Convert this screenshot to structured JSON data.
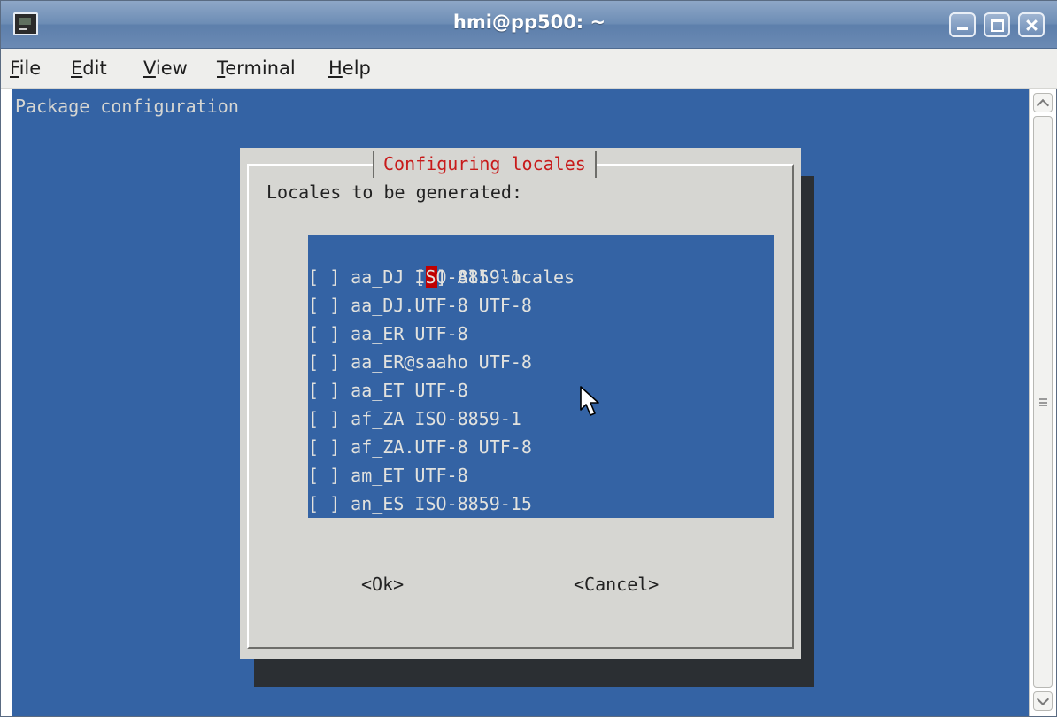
{
  "window": {
    "title": "hmi@pp500: ~"
  },
  "menubar": {
    "items": [
      {
        "label_ul": "F",
        "label_rest": "ile"
      },
      {
        "label_ul": "E",
        "label_rest": "dit"
      },
      {
        "label_ul": "V",
        "label_rest": "iew"
      },
      {
        "label_ul": "T",
        "label_rest": "erminal"
      },
      {
        "label_ul": "H",
        "label_rest": "elp"
      }
    ]
  },
  "terminal": {
    "header": "Package configuration",
    "background_color": "#3463a4"
  },
  "dialog": {
    "title": "Configuring locales",
    "prompt": "Locales to be generated:",
    "locales": [
      {
        "checkbox": "[ ]",
        "label": "All locales",
        "selected": true
      },
      {
        "checkbox": "[ ]",
        "label": "aa_DJ ISO-8859-1",
        "selected": false
      },
      {
        "checkbox": "[ ]",
        "label": "aa_DJ.UTF-8 UTF-8",
        "selected": false
      },
      {
        "checkbox": "[ ]",
        "label": "aa_ER UTF-8",
        "selected": false
      },
      {
        "checkbox": "[ ]",
        "label": "aa_ER@saaho UTF-8",
        "selected": false
      },
      {
        "checkbox": "[ ]",
        "label": "aa_ET UTF-8",
        "selected": false
      },
      {
        "checkbox": "[ ]",
        "label": "af_ZA ISO-8859-1",
        "selected": false
      },
      {
        "checkbox": "[ ]",
        "label": "af_ZA.UTF-8 UTF-8",
        "selected": false
      },
      {
        "checkbox": "[ ]",
        "label": "am_ET UTF-8",
        "selected": false
      },
      {
        "checkbox": "[ ]",
        "label": "an_ES ISO-8859-15",
        "selected": false
      }
    ],
    "ok_label": "<Ok>",
    "cancel_label": "<Cancel>",
    "title_color": "#c81a1a",
    "cursor_color": "#c00000"
  }
}
